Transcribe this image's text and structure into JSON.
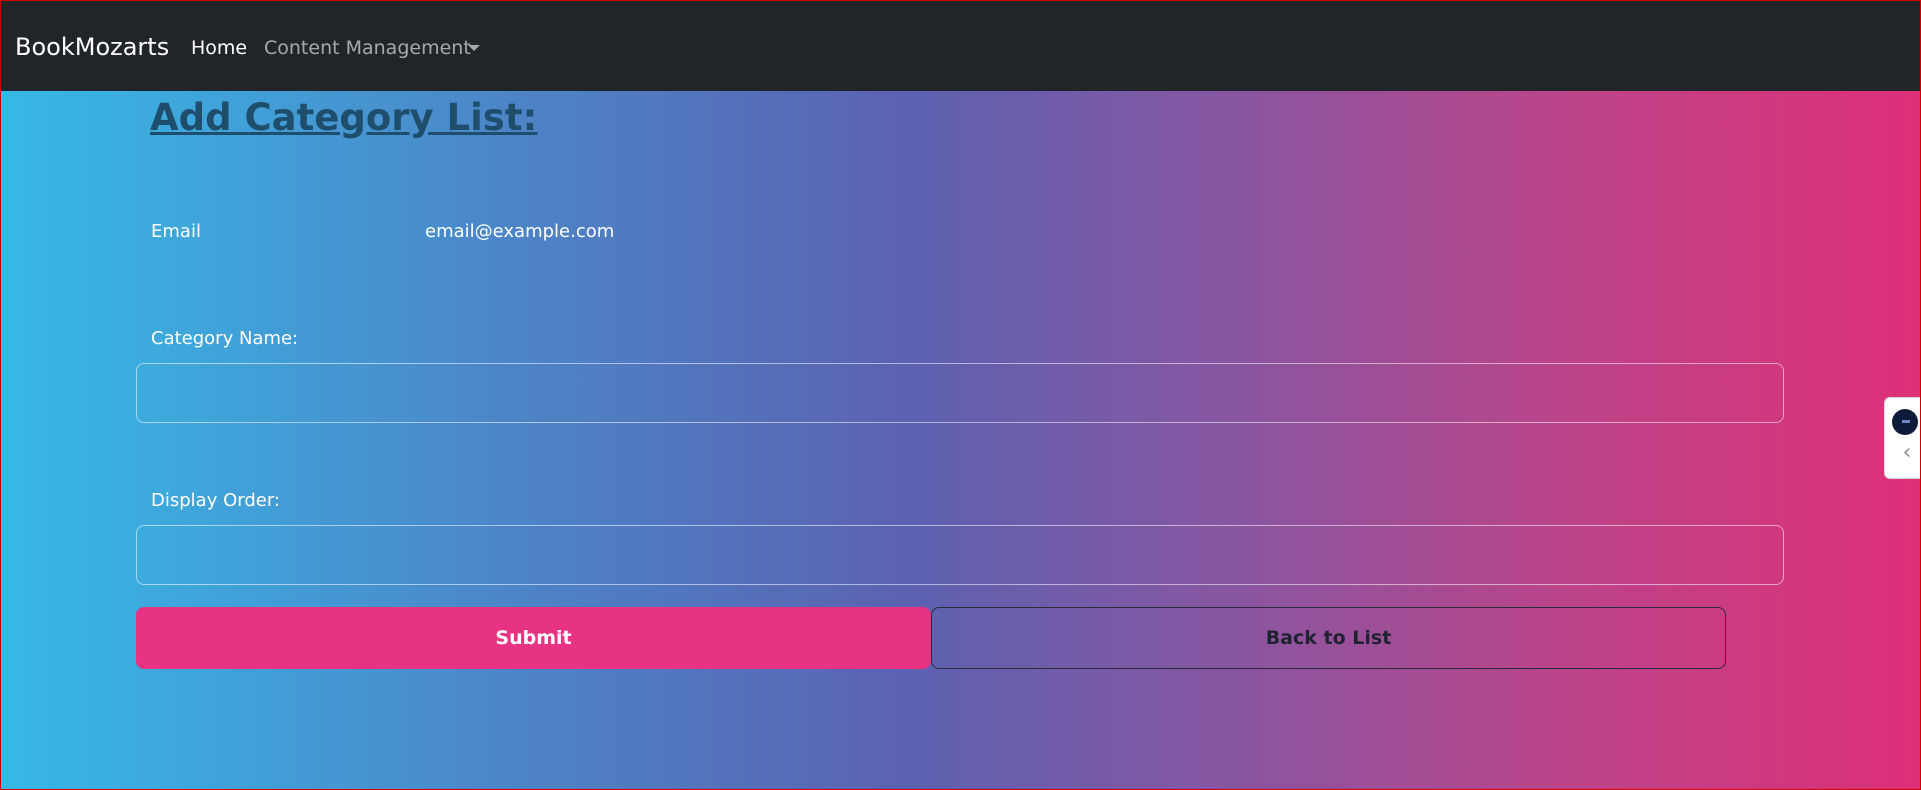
{
  "navbar": {
    "brand": "BookMozarts",
    "home": "Home",
    "content_management": "Content Management"
  },
  "page": {
    "title": "Add Category List:"
  },
  "form": {
    "email_label": "Email",
    "email_value": "email@example.com",
    "category_name_label": "Category Name:",
    "category_name_value": "",
    "display_order_label": "Display Order:",
    "display_order_value": "",
    "submit_label": "Submit",
    "back_label": "Back to List"
  },
  "icons": {
    "dropdown": "caret-down-icon",
    "widget_logo": "assistant-logo-icon",
    "widget_toggle": "chevron-left-icon"
  },
  "colors": {
    "navbar_bg": "#212529",
    "submit_bg": "#e83283",
    "title_color": "#1f4e6d",
    "gradient_start": "#36b9e6",
    "gradient_end": "#dd2f78"
  }
}
